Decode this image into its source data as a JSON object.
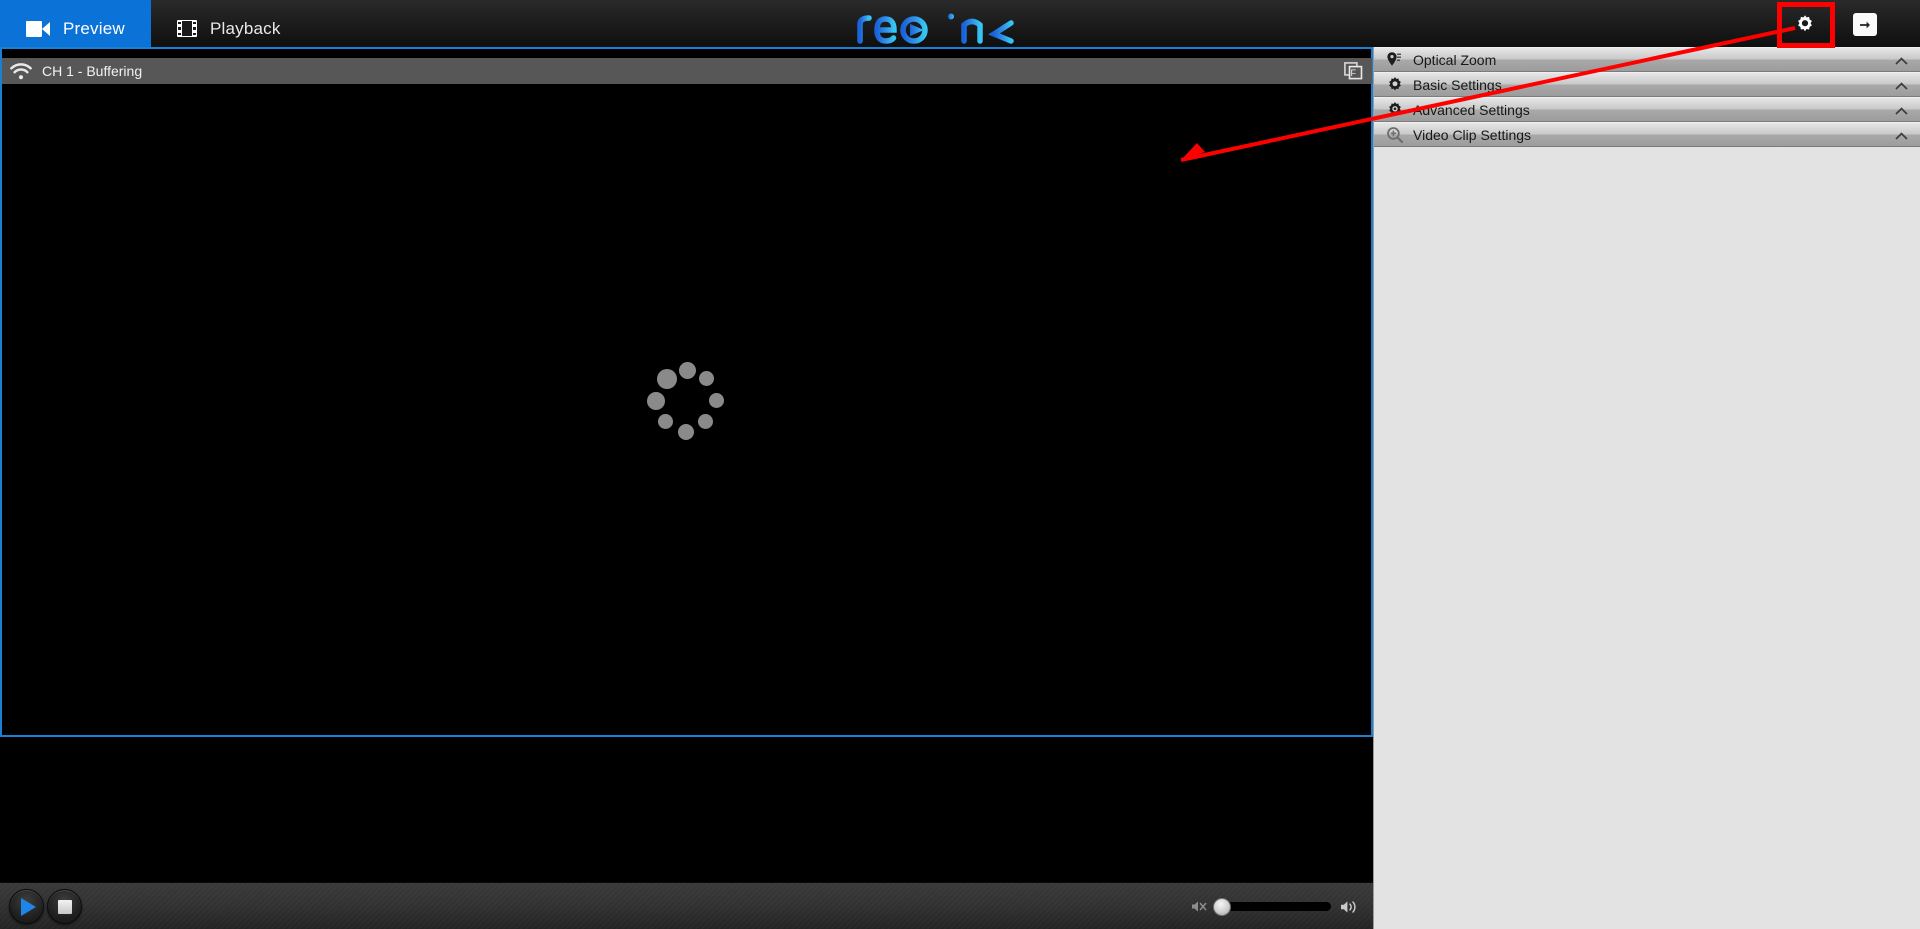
{
  "app": {
    "brand": "reolink",
    "brand_color": "#2f8fe8",
    "accent_color": "#0b72d8",
    "annotation_color": "#ff0000"
  },
  "topbar": {
    "tabs": [
      {
        "label": "Preview",
        "icon": "video-camera-icon",
        "active": true
      },
      {
        "label": "Playback",
        "icon": "film-strip-icon",
        "active": false
      }
    ],
    "settings_button": {
      "icon": "gear-icon",
      "label": "Settings",
      "highlighted": true
    },
    "exit_button": {
      "icon": "exit-arrow-icon",
      "label": "Log out"
    }
  },
  "channel": {
    "title": "CH 1 - Buffering",
    "signal_icon": "wifi-icon",
    "frame_icon": "frame-f-icon"
  },
  "video": {
    "state": "Buffering",
    "spinner_icon": "loading-spinner-icon",
    "spinner_dots": 8
  },
  "toolbar": {
    "play_button": {
      "icon": "play-icon",
      "label": "Play"
    },
    "stop_button": {
      "icon": "stop-icon",
      "label": "Stop"
    },
    "mute_button": {
      "icon": "speaker-mute-icon",
      "label": "Mute"
    },
    "volume_slider": {
      "value": 0,
      "min": 0,
      "max": 100
    },
    "volume_button": {
      "icon": "speaker-on-icon",
      "label": "Volume"
    }
  },
  "sidebar": {
    "items": [
      {
        "label": "Optical Zoom",
        "icon": "ptz-pin-icon",
        "expander": "chevron-up-icon"
      },
      {
        "label": "Basic Settings",
        "icon": "gear-icon",
        "expander": "chevron-up-icon"
      },
      {
        "label": "Advanced Settings",
        "icon": "gear-dot-icon",
        "expander": "chevron-up-icon"
      },
      {
        "label": "Video Clip Settings",
        "icon": "magnifier-plus-icon",
        "expander": "chevron-up-icon"
      }
    ]
  }
}
